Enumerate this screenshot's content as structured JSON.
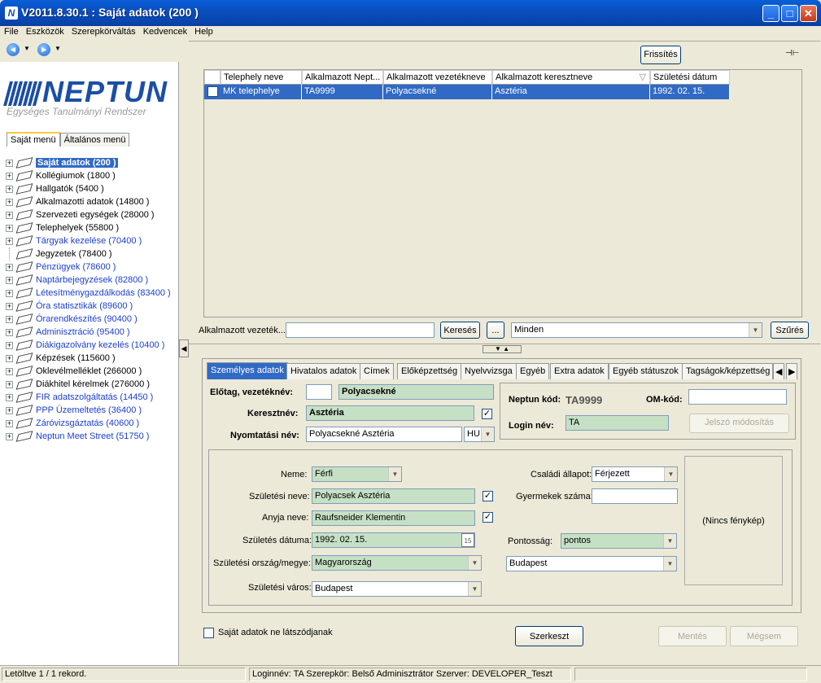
{
  "window": {
    "title": "V2011.8.30.1 : Saját adatok (200  )",
    "minimize": "_",
    "maximize": "□",
    "close": "✕"
  },
  "menu": [
    "File",
    "Eszközök",
    "Szerepkörváltás",
    "Kedvencek",
    "Help"
  ],
  "logo": {
    "name": "NEPTUN",
    "subtitle": "Egységes Tanulmányi Rendszer"
  },
  "left_tabs": [
    "Saját menü",
    "Általános menü"
  ],
  "tree": [
    {
      "label": "Saját adatok (200  )",
      "selected": true
    },
    {
      "label": "Kollégiumok (1800  )"
    },
    {
      "label": "Hallgatók (5400  )"
    },
    {
      "label": "Alkalmazotti adatok (14800  )"
    },
    {
      "label": "Szervezeti egységek (28000  )"
    },
    {
      "label": "Telephelyek (55800  )"
    },
    {
      "label": "Tárgyak kezelése (70400  )",
      "link": true
    },
    {
      "label": "Jegyzetek (78400  )",
      "noexp": true
    },
    {
      "label": "Pénzügyek (78600  )",
      "link": true
    },
    {
      "label": "Naptárbejegyzések (82800  )",
      "link": true
    },
    {
      "label": "Létesítménygazdálkodás (83400  )",
      "link": true
    },
    {
      "label": "Óra statisztikák (89600  )",
      "link": true
    },
    {
      "label": "Órarendkészítés (90400  )",
      "link": true
    },
    {
      "label": "Adminisztráció (95400  )",
      "link": true
    },
    {
      "label": "Diákigazolvány kezelés (10400  )",
      "link": true
    },
    {
      "label": "Képzések (115600  )"
    },
    {
      "label": "Oklevélmelléklet (266000  )"
    },
    {
      "label": "Diákhitel kérelmek (276000  )"
    },
    {
      "label": "FIR adatszolgáltatás (14450  )",
      "link": true
    },
    {
      "label": "PPP Üzemeltetés (36400  )",
      "link": true
    },
    {
      "label": "Záróvizsgáztatás (40600  )",
      "link": true
    },
    {
      "label": "Neptun Meet Street (51750  )",
      "link": true
    }
  ],
  "toolbar": {
    "refresh": "Frissítés",
    "pin": "⊣⊢"
  },
  "grid": {
    "columns": [
      "Telephely neve",
      "Alkalmazott Nept...",
      "Alkalmazott vezetékneve",
      "Alkalmazott keresztneve",
      "Születési dátum"
    ],
    "rows": [
      [
        "MK telephelye",
        "TA9999",
        "Polyacsekné",
        "Asztéria",
        "1992. 02. 15."
      ]
    ]
  },
  "search": {
    "label": "Alkalmazott vezeték...",
    "value": "",
    "search_btn": "Keresés",
    "dots_btn": "...",
    "filter": "Minden",
    "filter_btn": "Szűrés"
  },
  "form_tabs": [
    "Személyes adatok",
    "Hivatalos adatok",
    "Címek",
    "Előképzettség",
    "Nyelvvizsga",
    "Egyéb",
    "Extra adatok",
    "Egyéb státuszok",
    "Tagságok/képzettség"
  ],
  "form": {
    "prefix_label": "Előtag, vezetéknév:",
    "prefix": "",
    "surname": "Polyacsekné",
    "firstname_label": "Keresztnév:",
    "firstname": "Asztéria",
    "print_label": "Nyomtatási név:",
    "print_name": "Polyacsekné Asztéria",
    "print_lang": "HU",
    "neptun_label": "Neptun kód:",
    "neptun": "TA9999",
    "om_label": "OM-kód:",
    "om": "",
    "login_label": "Login név:",
    "login": "TA",
    "pwd_btn": "Jelszó módosítás",
    "gender_label": "Neme:",
    "gender": "Férfi",
    "birthname_label": "Születési neve:",
    "birthname": "Polyacsek Asztéria",
    "mother_label": "Anyja neve:",
    "mother": "Raufsneider Klementin",
    "birthdate_label": "Születés dátuma:",
    "birthdate": "1992. 02. 15.",
    "cal": "15",
    "country_label": "Születési ország/megye:",
    "country": "Magyarország",
    "city_label": "Születési város:",
    "city": "Budapest",
    "marital_label": "Családi állapot:",
    "marital": "Férjezett",
    "children_label": "Gyermekek száma:",
    "children": "",
    "accuracy_label": "Pontosság:",
    "accuracy": "pontos",
    "county": "Budapest",
    "photo": "(Nincs fénykép)"
  },
  "bottom": {
    "hide_label": "Saját adatok ne látszódjanak",
    "edit": "Szerkeszt",
    "save": "Mentés",
    "cancel": "Mégsem"
  },
  "status": {
    "records": "Letöltve 1 / 1 rekord.",
    "login": "Loginnév: TA   Szerepkör: Belső Adminisztrátor   Szerver: DEVELOPER_Teszt"
  }
}
